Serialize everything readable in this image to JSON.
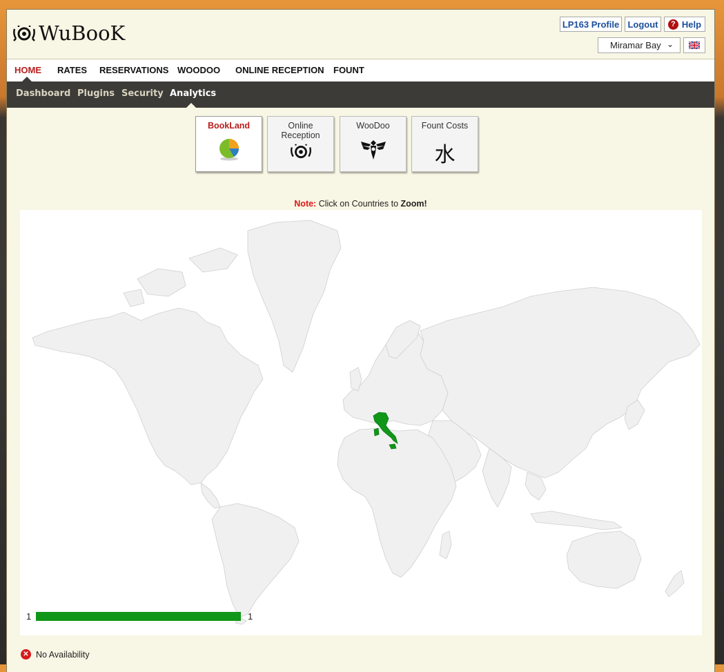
{
  "app": {
    "name": "WuBooK"
  },
  "toolbar": {
    "profile_label": "LP163 Profile",
    "logout_label": "Logout",
    "help_label": "Help",
    "property_selected": "Miramar Bay",
    "language_flag": "uk-flag-icon"
  },
  "mainnav": {
    "items": [
      {
        "label": "HOME",
        "active": true
      },
      {
        "label": "RATES"
      },
      {
        "label": "RESERVATIONS"
      },
      {
        "label": "WOODOO"
      },
      {
        "label": "ONLINE RECEPTION"
      },
      {
        "label": "FOUNT"
      }
    ]
  },
  "subnav": {
    "items": [
      {
        "label": "Dashboard"
      },
      {
        "label": "Plugins"
      },
      {
        "label": "Security"
      },
      {
        "label": "Analytics",
        "active": true
      }
    ]
  },
  "apps": [
    {
      "label": "BookLand",
      "icon": "pie-chart-icon",
      "active": true
    },
    {
      "label": "Online Reception",
      "icon": "wubook-logo-icon"
    },
    {
      "label": "WooDoo",
      "icon": "bird-emblem-icon"
    },
    {
      "label": "Fount Costs",
      "icon": "water-kanji-icon",
      "glyph": "水"
    }
  ],
  "note": {
    "prefix": "Note:",
    "text": " Click on Countries to ",
    "emphasis": "Zoom!"
  },
  "map": {
    "highlighted_country": "Italy",
    "highlight_color": "#109618",
    "base_color": "#f0f0f0",
    "legend": {
      "min": "1",
      "max": "1",
      "color": "#109618"
    }
  },
  "status": {
    "no_availability_label": "No Availability"
  }
}
